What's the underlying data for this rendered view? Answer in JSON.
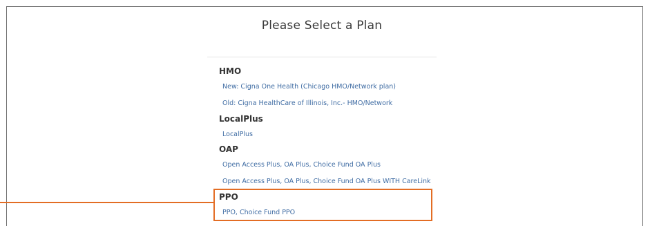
{
  "header": {
    "title": "Please Select a Plan"
  },
  "plans": {
    "hmo": {
      "category": "HMO",
      "items": [
        "New: Cigna One Health (Chicago HMO/Network plan)",
        "Old: Cigna HealthCare of Illinois, Inc.- HMO/Network"
      ]
    },
    "localplus": {
      "category": "LocalPlus",
      "items": [
        "LocalPlus"
      ]
    },
    "oap": {
      "category": "OAP",
      "items": [
        "Open Access Plus, OA Plus, Choice Fund OA Plus",
        "Open Access Plus, OA Plus, Choice Fund OA Plus WITH CareLink"
      ]
    },
    "ppo": {
      "category": "PPO",
      "items": [
        "PPO, Choice Fund PPO"
      ]
    }
  },
  "colors": {
    "link": "#3f6ca3",
    "highlight": "#e36d24",
    "heading": "#333333"
  }
}
